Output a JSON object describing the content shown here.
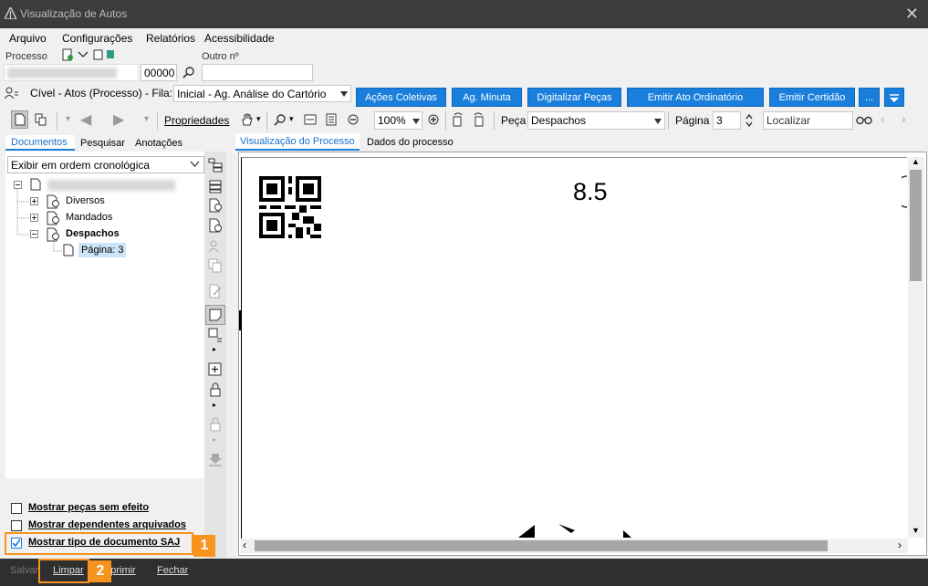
{
  "window": {
    "title": "Visualização de Autos",
    "close": "✕"
  },
  "menu": {
    "arquivo": "Arquivo",
    "configuracoes": "Configurações",
    "relatorios": "Relatórios",
    "acessibilidade": "Acessibilidade"
  },
  "processo": {
    "label": "Processo",
    "outro_label": "Outro nº",
    "number_suffix": "00000",
    "outro_value": ""
  },
  "fila": {
    "text": "Cível - Atos (Processo) - Fila:",
    "selected": "Inicial - Ag. Análise do Cartório",
    "buttons": [
      "Ações Coletivas",
      "Ag. Minuta",
      "Digitalizar Peças",
      "Emitir Ato Ordinatório",
      "Emitir Certidão",
      "..."
    ]
  },
  "toolbar": {
    "propriedades": "Propriedades",
    "zoom": "100%",
    "peca_label": "Peça",
    "peca_value": "Despachos",
    "pagina_label": "Página",
    "pagina_value": "3",
    "localizar_placeholder": "Localizar"
  },
  "left_tabs": [
    "Documentos",
    "Pesquisar",
    "Anotações"
  ],
  "order_select": "Exibir em ordem cronológica",
  "tree": {
    "diversos": "Diversos",
    "mandados": "Mandados",
    "despachos": "Despachos",
    "pagina": "Página: 3"
  },
  "options": {
    "pecas_sem_efeito": "Mostrar peças sem efeito",
    "dependentes_arquivados": "Mostrar dependentes arquivados",
    "tipo_documento_saj": "Mostrar tipo de documento SAJ"
  },
  "right_tabs": [
    "Visualização do Processo",
    "Dados do processo"
  ],
  "document": {
    "page_number": "8.5"
  },
  "status": {
    "salvar": "Salvar",
    "limpar": "Limpar",
    "imprimir": "Imprimir",
    "fechar": "Fechar"
  },
  "badges": [
    "1",
    "2"
  ],
  "colors": {
    "accent": "#1a7fdc",
    "badge": "#f7931e",
    "titlebar": "#3c3c3c"
  }
}
